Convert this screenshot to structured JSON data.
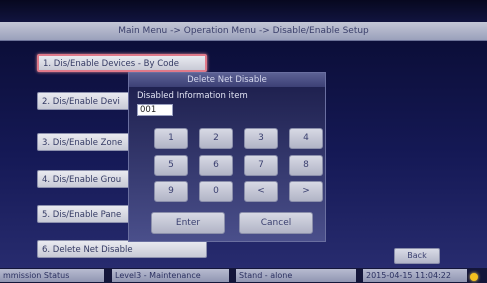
{
  "breadcrumb": "Main Menu -> Operation Menu -> Disable/Enable Setup",
  "menu": {
    "items": [
      {
        "label": "1. Dis/Enable Devices - By Code"
      },
      {
        "label": "2. Dis/Enable Devi"
      },
      {
        "label": "3. Dis/Enable Zone"
      },
      {
        "label": "4. Dis/Enable Grou"
      },
      {
        "label": "5. Dis/Enable Pane"
      },
      {
        "label": "6. Delete Net Disable"
      }
    ]
  },
  "dialog": {
    "title": "Delete Net Disable",
    "field_label": "Disabled Information item",
    "field_value": "001",
    "keys": [
      "1",
      "2",
      "3",
      "4",
      "5",
      "6",
      "7",
      "8",
      "9",
      "0",
      "<",
      ">"
    ],
    "enter_label": "Enter",
    "cancel_label": "Cancel"
  },
  "back_label": "Back",
  "status": {
    "commission": "mmission Status",
    "level": "Level3 - Maintenance",
    "mode": "Stand - alone",
    "datetime": "2015-04-15 11:04:22",
    "indicator_color": "#f4c020"
  }
}
